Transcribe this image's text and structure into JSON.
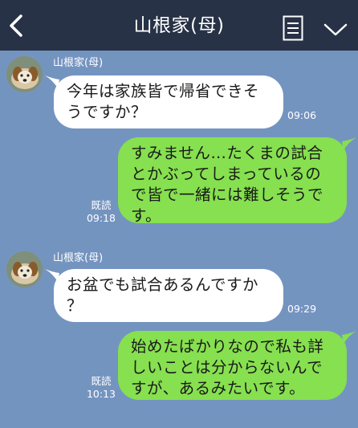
{
  "header": {
    "title": "山根家(母)"
  },
  "colors": {
    "header_bg": "#273246",
    "chat_bg": "#7494c0",
    "incoming_bubble": "#ffffff",
    "outgoing_bubble": "#86e04f"
  },
  "icons": {
    "back": "chevron-left-icon",
    "memo": "memo-icon",
    "menu": "chevron-down-icon"
  },
  "messages": [
    {
      "direction": "incoming",
      "sender": "山根家(母)",
      "text": "今年は家族皆で帰省できそ\nうですか？",
      "time": "09:06"
    },
    {
      "direction": "outgoing",
      "text": "すみません…たくまの試合\nとかぶってしまっているの\nで皆で一緒には難しそうで\nす。",
      "read": "既読",
      "time": "09:18"
    },
    {
      "direction": "incoming",
      "sender": "山根家(母)",
      "text": "お盆でも試合あるんですか\n？",
      "time": "09:29"
    },
    {
      "direction": "outgoing",
      "text": "始めたばかりなので私も詳\nしいことは分からないんで\nすが、あるみたいです。",
      "read": "既読",
      "time": "10:13"
    }
  ]
}
